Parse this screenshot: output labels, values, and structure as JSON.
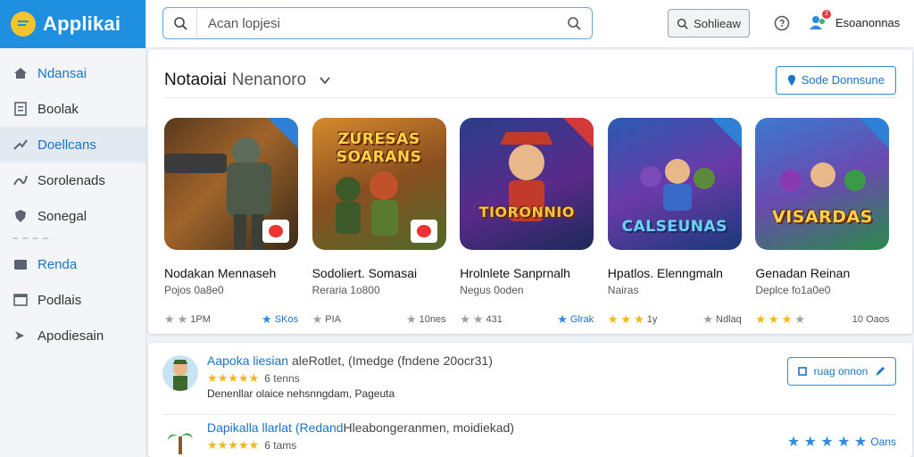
{
  "app": {
    "title": "Applikai"
  },
  "sidebar": {
    "items": [
      {
        "label": "Ndansai",
        "icon": "home-icon"
      },
      {
        "label": "Boolak",
        "icon": "document-icon"
      },
      {
        "label": "Doellcans",
        "icon": "trending-icon"
      },
      {
        "label": "Sorolenads",
        "icon": "chart-line-icon"
      },
      {
        "label": "Sonegal",
        "icon": "shield-icon"
      },
      {
        "label": "Renda",
        "icon": "folder-icon"
      },
      {
        "label": "Podlais",
        "icon": "window-icon"
      },
      {
        "label": "Apodiesain",
        "icon": "arrow-icon"
      }
    ]
  },
  "topbar": {
    "search_placeholder": "Acan lopjesi",
    "button_label": "Sohlieaw",
    "user_name": "Esoanonnas",
    "notification_count": "2"
  },
  "section": {
    "title": "Notaoiai",
    "title_sub": "Nenanoro",
    "button_label": "Sode Donnsune"
  },
  "games": [
    {
      "art": "",
      "title": "Nodakan Mennaseh",
      "subtitle": "Pojos 0a8e0",
      "meta_left": "1PM",
      "meta_right": "SKos"
    },
    {
      "art": "ZURESAS SOARANS",
      "title": "Sodoliert. Somasai",
      "subtitle": "Reraria 1o800",
      "meta_left": "PIA",
      "meta_right": "10nes"
    },
    {
      "art": "TIORONNIO",
      "title": "Hrolnlete Sanprnalh",
      "subtitle": "Negus 0oden",
      "meta_left": "431",
      "meta_right": "Glrak"
    },
    {
      "art": "CALSEUNAS",
      "title": "Hpatlos. Elenngmaln",
      "subtitle": "Nairas",
      "meta_left": "1y",
      "meta_right": "Ndlaq"
    },
    {
      "art": "VISARDAS",
      "title": "Genadan Reinan",
      "subtitle": "Deplce fo1a0e0",
      "meta_left": "",
      "meta_right": "10 Oaos"
    }
  ],
  "list": [
    {
      "name": "Aapoka liesian",
      "rest": " aleRotlet, (Imedge (fndene 20ocr31)",
      "rating_text": "6 tenns",
      "desc": "Denenllar olaice nehsnngdam, Pageuta",
      "button_label": "ruag onnon"
    },
    {
      "name": "Dapikalla llarlat (Redand",
      "rest": "Hleabongeranmen, moidiekad)",
      "rating_text": "6 tams",
      "desc": "",
      "right_rating": "Oans"
    }
  ],
  "colors": {
    "accent": "#1f8fe0",
    "brand_yellow": "#f7c52b",
    "star_gold": "#f2b51a"
  }
}
